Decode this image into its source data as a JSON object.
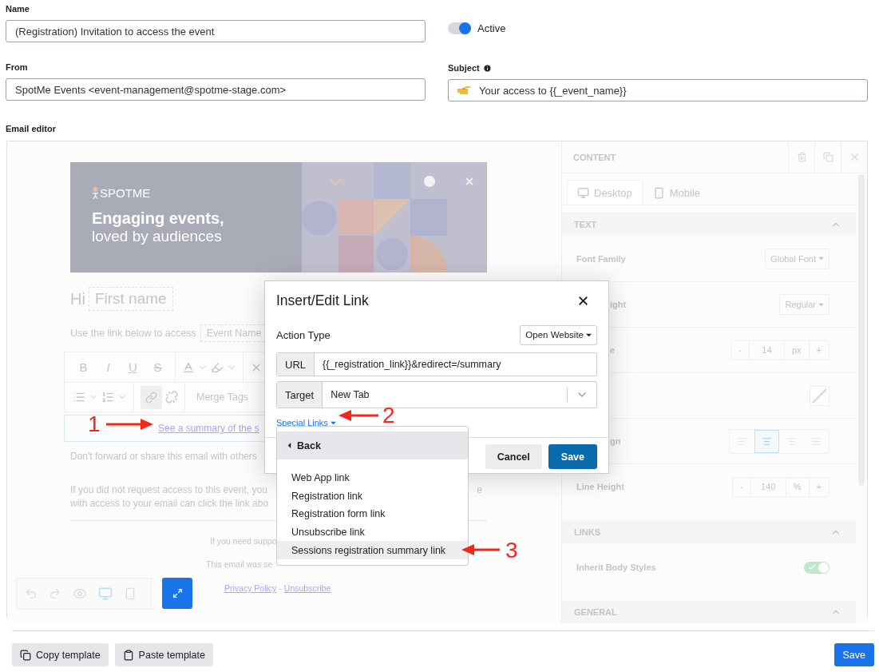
{
  "form": {
    "name": {
      "label": "Name",
      "value": "(Registration) Invitation to access the event"
    },
    "active": {
      "label": "Active",
      "on": true
    },
    "from": {
      "label": "From",
      "value": "SpotMe Events <event-management@spotme-stage.com>"
    },
    "subject": {
      "label": "Subject",
      "value": "Your access to {{_event_name}}"
    },
    "editor_label": "Email editor"
  },
  "email": {
    "logo": "SPOTME",
    "headline": "Engaging events,",
    "tagline": "loved by audiences",
    "greeting": "Hi",
    "greeting_tag": "First name",
    "intro": "Use the link below to access",
    "intro_tag": "Event Name",
    "format_buttons": [
      "B",
      "I",
      "U",
      "S"
    ],
    "link_active": true,
    "merge_tags": "Merge Tags",
    "link_text": "See a summary of the s",
    "paragraphs": [
      {
        "text": "Don't forward or share this email with others"
      },
      {
        "text": "If you did not request access to this event, you",
        "tail": "e"
      },
      {
        "text": "with access to your email can click the link abo"
      }
    ],
    "footer_lines": [
      "If you need suppo",
      "This email was se"
    ],
    "footer_links": [
      "Privacy Policy",
      "Unsubscribe"
    ],
    "footer_separator": "-"
  },
  "panel": {
    "title": "CONTENT",
    "tabs": [
      {
        "label": "Desktop",
        "selected": true
      },
      {
        "label": "Mobile",
        "selected": false
      }
    ],
    "sections": [
      {
        "title": "TEXT",
        "rows": [
          {
            "kind": "select",
            "label": "Font Family",
            "value": "Global Font"
          },
          {
            "kind": "select",
            "label": "ight",
            "value": "Regular",
            "cut": true
          },
          {
            "kind": "stepper",
            "label": "e",
            "value": "14",
            "unit": "px",
            "decrement": "-",
            "increment": "+",
            "cut": true
          },
          {
            "kind": "color"
          },
          {
            "kind": "align",
            "label": "gn",
            "cut": true,
            "options": [
              {
                "selected": false
              },
              {
                "selected": true
              },
              {
                "selected": false
              },
              {
                "selected": false
              }
            ]
          },
          {
            "kind": "stepper",
            "label": "Line Height",
            "value": "140",
            "unit": "%",
            "decrement": "-",
            "increment": "+"
          }
        ]
      },
      {
        "title": "LINKS",
        "rows": [
          {
            "kind": "toggle",
            "label": "Inherit Body Styles",
            "on": true
          }
        ]
      },
      {
        "title": "GENERAL"
      }
    ]
  },
  "modal": {
    "title": "Insert/Edit Link",
    "action_type_label": "Action Type",
    "action_type_value": "Open Website",
    "url_label": "URL",
    "url_value": "{{_registration_link}}&redirect=/summary",
    "target_label": "Target",
    "target_value": "New Tab",
    "special_links": "Special Links",
    "cancel": "Cancel",
    "save": "Save"
  },
  "special_menu": {
    "back": "Back",
    "items": [
      {
        "label": "Web App link",
        "selected": false
      },
      {
        "label": "Registration link",
        "selected": false
      },
      {
        "label": "Registration form link",
        "selected": false
      },
      {
        "label": "Unsubscribe link",
        "selected": false
      },
      {
        "label": "Sessions registration summary link",
        "selected": true
      }
    ]
  },
  "annotations": [
    {
      "label": "1"
    },
    {
      "label": "2"
    },
    {
      "label": "3"
    }
  ],
  "footer": {
    "buttons": [
      "Copy template",
      "Paste template"
    ],
    "save": "Save"
  }
}
